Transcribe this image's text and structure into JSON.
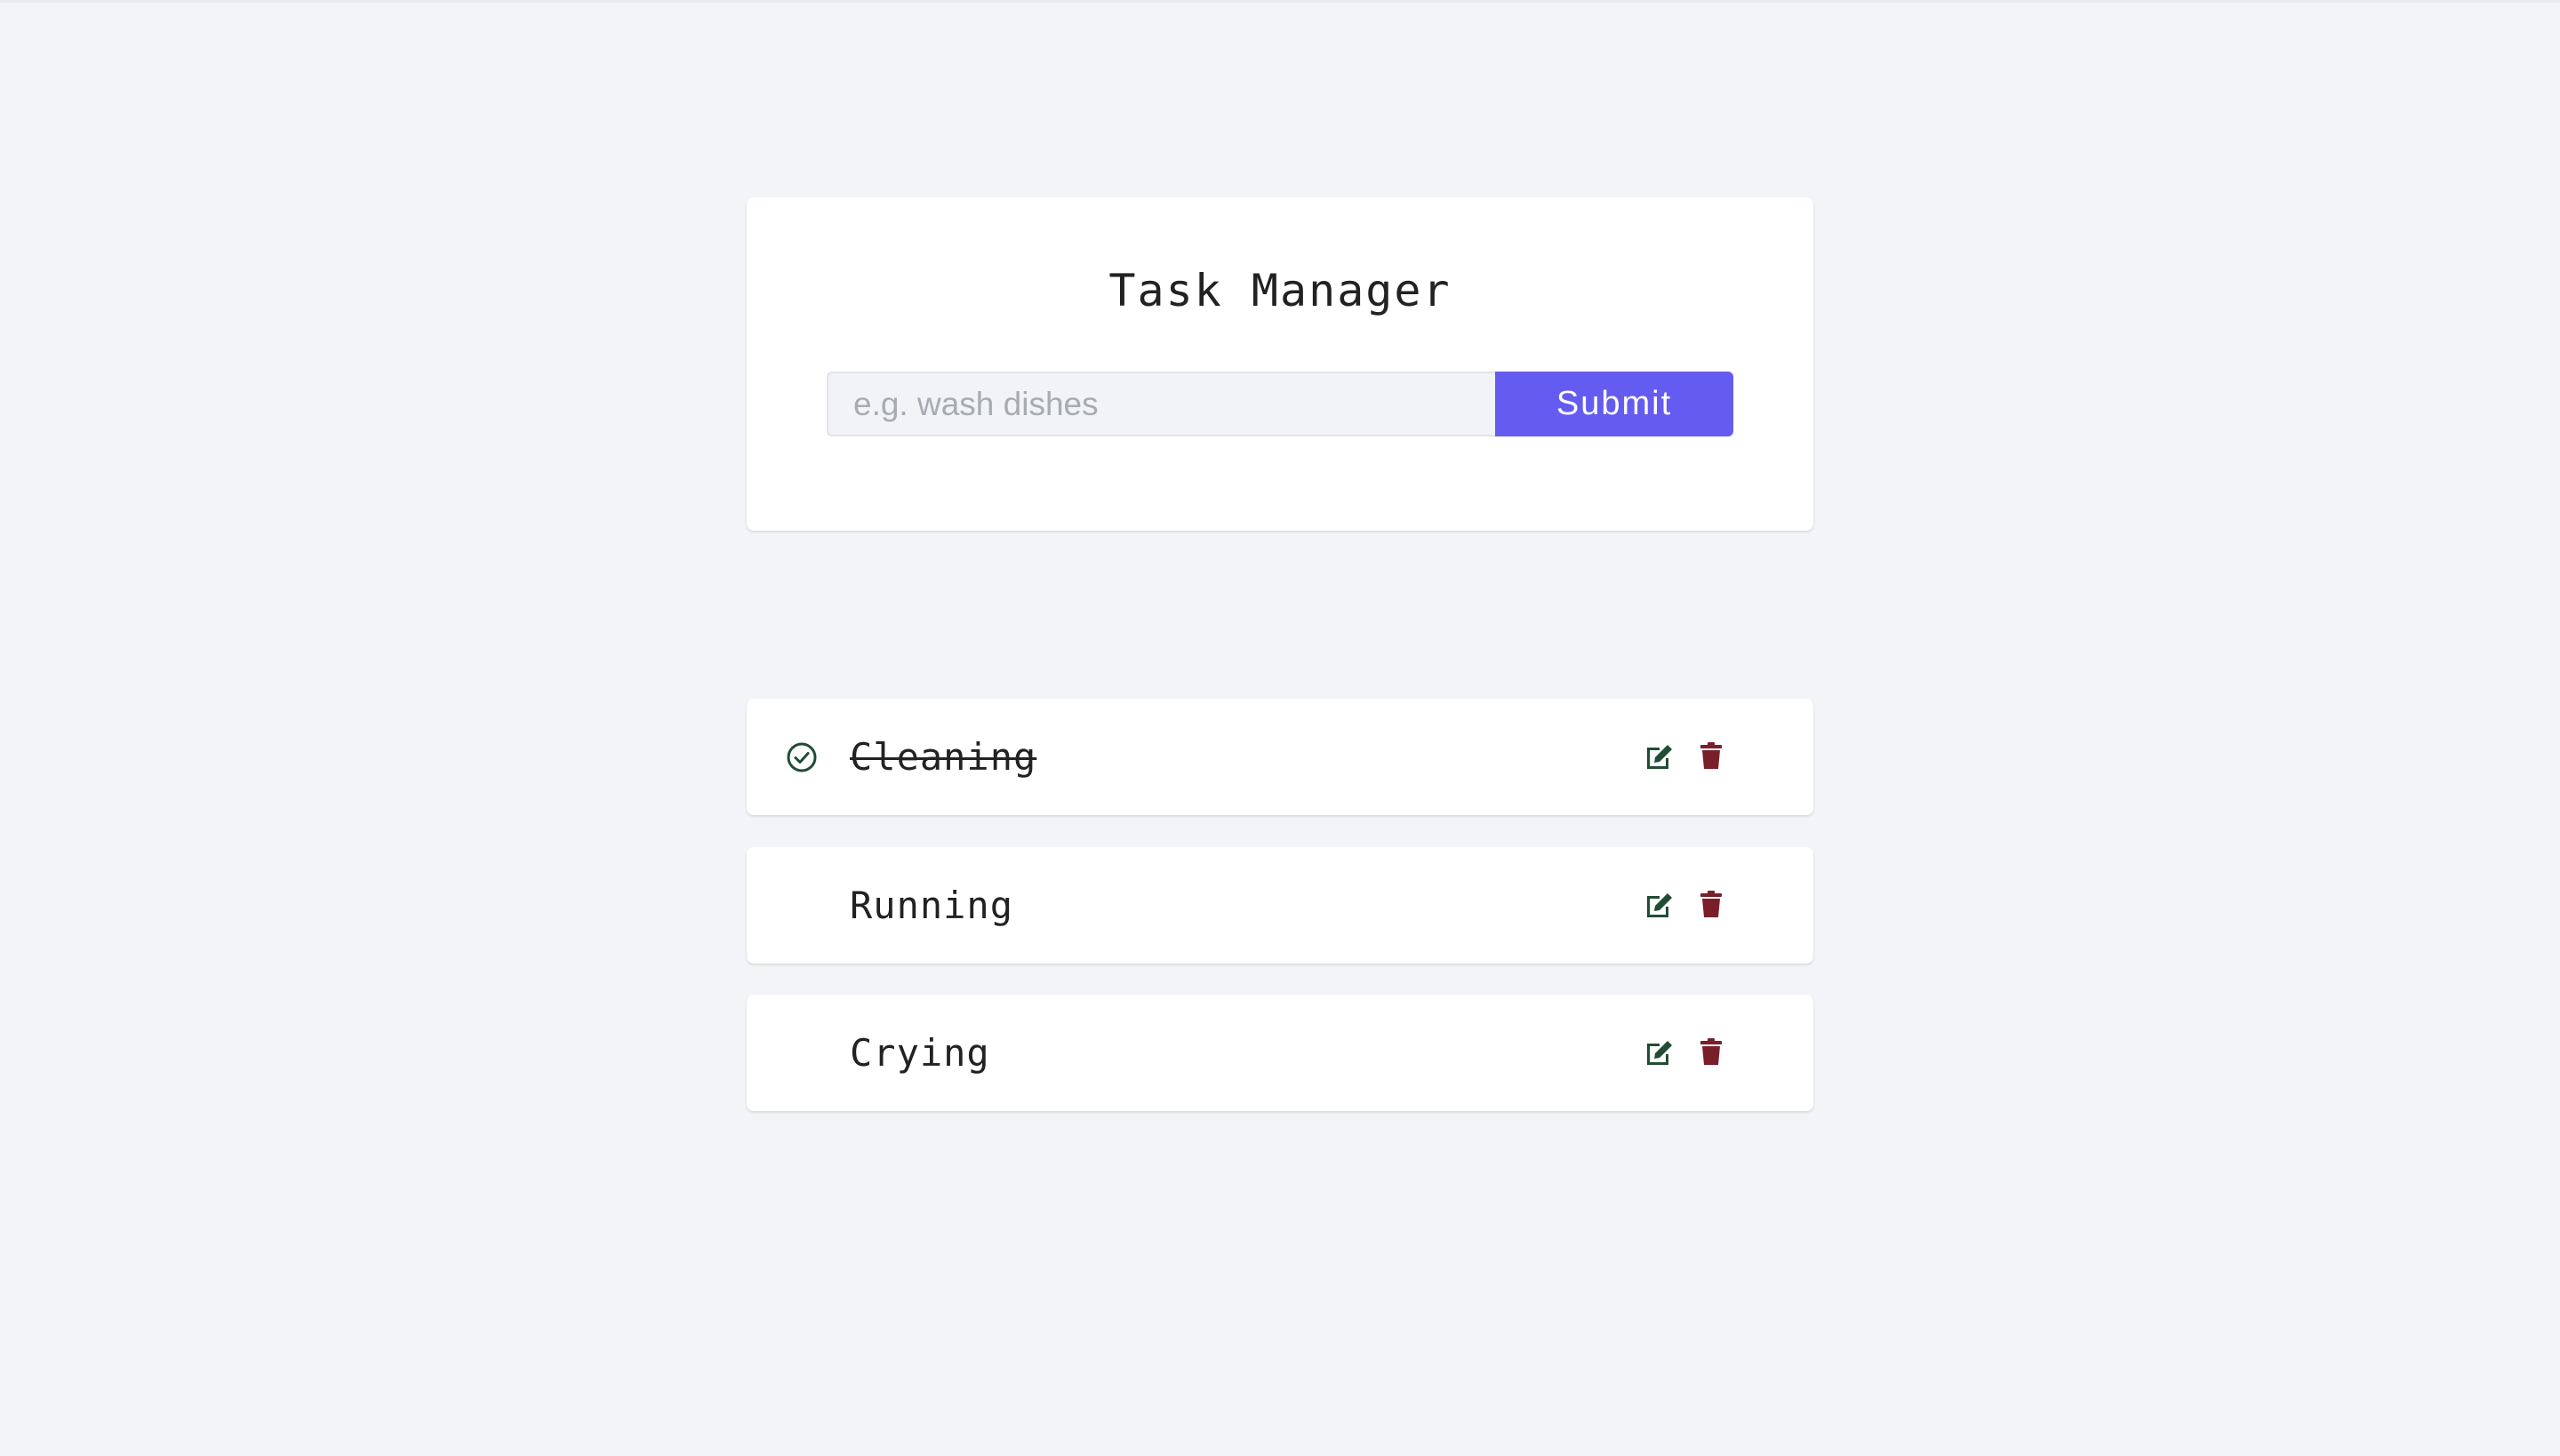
{
  "app": {
    "title": "Task Manager"
  },
  "form": {
    "input_placeholder": "e.g. wash dishes",
    "input_value": "",
    "submit_label": "Submit"
  },
  "tasks": [
    {
      "name": "Cleaning",
      "completed": true
    },
    {
      "name": "Running",
      "completed": false
    },
    {
      "name": "Crying",
      "completed": false
    }
  ],
  "icons": {
    "completed": "check-circle-icon",
    "edit": "edit-icon",
    "delete": "trash-icon"
  },
  "colors": {
    "background": "#f2f4f8",
    "card": "#ffffff",
    "accent": "#645cf1",
    "edit_icon": "#1f4d34",
    "delete_icon": "#7a1f2a",
    "check_icon": "#1f4d34",
    "text": "#222222"
  }
}
